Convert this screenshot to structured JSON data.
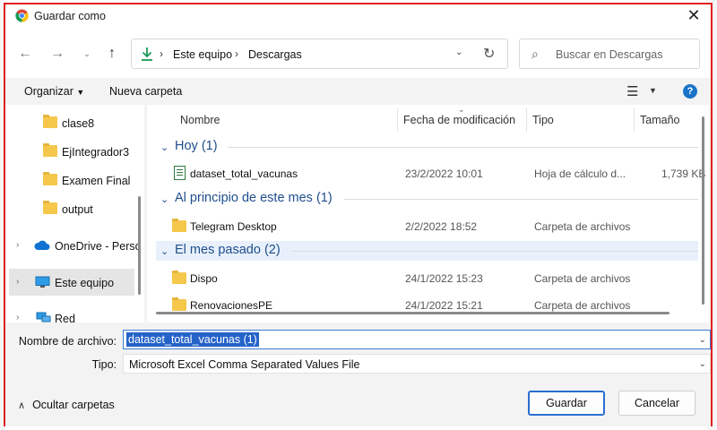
{
  "title": "Guardar como",
  "address": {
    "segments": [
      "Este equipo",
      "Descargas"
    ]
  },
  "search": {
    "placeholder": "Buscar en Descargas"
  },
  "toolbar": {
    "organize": "Organizar",
    "new_folder": "Nueva carpeta"
  },
  "nav_pane": {
    "folders": [
      "clase8",
      "EjIntegrador3",
      "Examen Final",
      "output"
    ],
    "onedrive": "OneDrive - Perso",
    "this_pc": "Este equipo",
    "network": "Red"
  },
  "columns": {
    "name": "Nombre",
    "date": "Fecha de modificación",
    "type": "Tipo",
    "size": "Tamaño"
  },
  "groups": [
    {
      "label": "Hoy (1)",
      "rows": [
        {
          "name": "dataset_total_vacunas",
          "date": "23/2/2022 10:01",
          "type": "Hoja de cálculo d...",
          "size": "1,739 KB",
          "icon": "spreadsheet-icon"
        }
      ]
    },
    {
      "label": "Al principio de este mes (1)",
      "rows": [
        {
          "name": "Telegram Desktop",
          "date": "2/2/2022 18:52",
          "type": "Carpeta de archivos",
          "size": "",
          "icon": "folder-icon"
        }
      ]
    },
    {
      "label": "El mes pasado (2)",
      "rows": [
        {
          "name": "Dispo",
          "date": "24/1/2022 15:23",
          "type": "Carpeta de archivos",
          "size": "",
          "icon": "folder-icon"
        },
        {
          "name": "RenovacionesPE",
          "date": "24/1/2022 15:21",
          "type": "Carpeta de archivos",
          "size": "",
          "icon": "folder-icon"
        }
      ]
    }
  ],
  "form": {
    "filename_label": "Nombre de archivo:",
    "filename_value": "dataset_total_vacunas (1)",
    "type_label": "Tipo:",
    "type_value": "Microsoft Excel Comma Separated Values File"
  },
  "footer": {
    "hide_folders": "Ocultar carpetas",
    "save": "Guardar",
    "cancel": "Cancelar"
  },
  "colors": {
    "accent": "#2563c9",
    "group_header": "#1f4e8c",
    "highlight_border": "#e02020"
  }
}
